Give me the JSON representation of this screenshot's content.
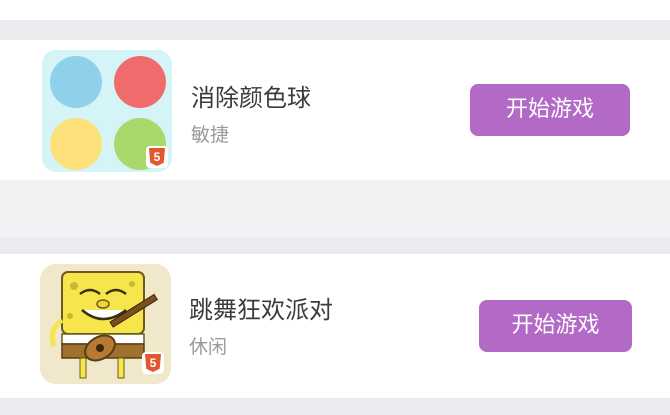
{
  "games": [
    {
      "title": "消除颜色球",
      "category": "敏捷",
      "button_label": "开始游戏",
      "icon": "color-balls-icon",
      "badge": "5",
      "ball_colors": [
        "#8fd1ea",
        "#f06b6b",
        "#fde07a",
        "#a8d96a"
      ]
    },
    {
      "title": "跳舞狂欢派对",
      "category": "休闲",
      "button_label": "开始游戏",
      "icon": "sponge-character-icon",
      "badge": "5"
    }
  ],
  "colors": {
    "button": "#b369c6",
    "page_background": "#eeedf0",
    "card_background": "#ffffff"
  }
}
